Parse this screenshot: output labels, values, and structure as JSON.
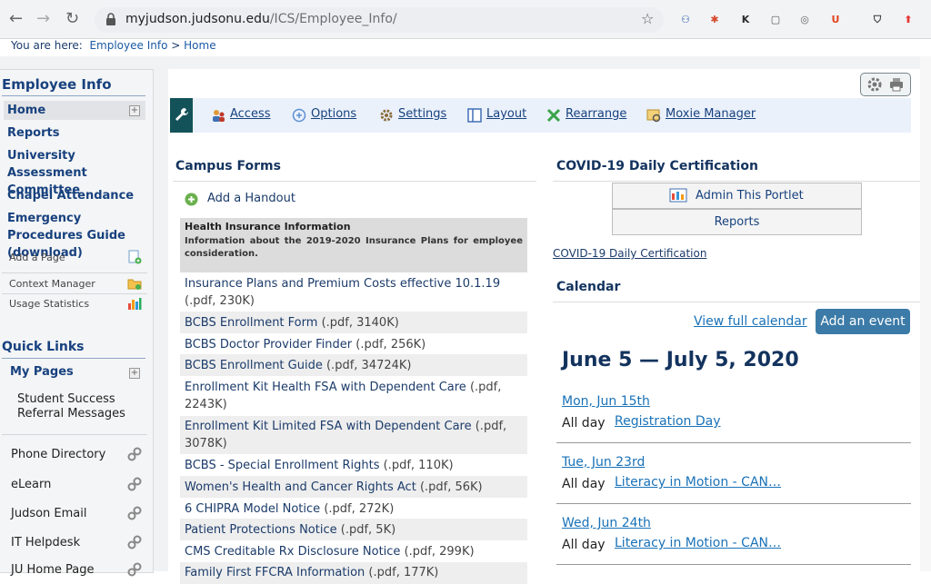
{
  "browser": {
    "url_host": "myjudson.judsonu.edu",
    "url_path": "/ICS/Employee_Info/",
    "extensions": [
      {
        "name": "ext-badge-blue",
        "color": "#2a56a6",
        "glyph": "⚇"
      },
      {
        "name": "ext-flame",
        "color": "#d5462a",
        "glyph": "✱"
      },
      {
        "name": "ext-k",
        "color": "#2b2b2b",
        "glyph": "K"
      },
      {
        "name": "ext-frame",
        "color": "#555555",
        "glyph": "▢"
      },
      {
        "name": "ext-swirl",
        "color": "#666666",
        "glyph": "◎"
      },
      {
        "name": "ext-u",
        "color": "#e2441f",
        "glyph": "U"
      },
      {
        "name": "ext-shield",
        "color": "#3a3a3a",
        "glyph": "⛉"
      },
      {
        "name": "ext-red-up",
        "color": "#e53935",
        "glyph": "⬆"
      }
    ]
  },
  "breadcrumb": {
    "prefix": "You are here:",
    "part1": "Employee Info",
    "sep": ">",
    "part2": "Home"
  },
  "sidebar": {
    "heading": "Employee Info",
    "items": [
      {
        "label": "Home"
      },
      {
        "label": "Reports"
      },
      {
        "label": "University Assessment Committee"
      },
      {
        "label": "Chapel Attendance"
      },
      {
        "label": "Emergency Procedures Guide (download)"
      }
    ],
    "tools": [
      "Add a Page",
      "Context Manager",
      "Usage Statistics"
    ],
    "quick_links_heading": "Quick Links",
    "my_pages": "My Pages",
    "student_success": "Student Success Referral Messages",
    "links": [
      "Phone Directory",
      "eLearn",
      "Judson Email",
      "IT Helpdesk",
      "JU Home Page"
    ]
  },
  "toolbar": {
    "items": [
      "Access",
      "Options",
      "Settings",
      "Layout",
      "Rearrange",
      "Moxie Manager"
    ]
  },
  "campus_forms": {
    "title": "Campus Forms",
    "add_handout": "Add a Handout",
    "hi_title": "Health Insurance Information",
    "hi_desc": "Information about the 2019-2020 Insurance Plans for employee consideration.",
    "rows": [
      {
        "label": "Insurance Plans and Premium Costs effective 10.1.19",
        "meta": "(.pdf, 230K)"
      },
      {
        "label": "BCBS Enrollment Form",
        "meta": "(.pdf, 3140K)"
      },
      {
        "label": "BCBS Doctor Provider Finder",
        "meta": "(.pdf, 256K)"
      },
      {
        "label": "BCBS Enrollment Guide",
        "meta": "(.pdf, 34724K)"
      },
      {
        "label": "Enrollment Kit Health FSA with Dependent Care",
        "meta": "(.pdf, 2243K)"
      },
      {
        "label": "Enrollment Kit Limited FSA with Dependent Care",
        "meta": "(.pdf, 3078K)"
      },
      {
        "label": "BCBS - Special Enrollment Rights",
        "meta": "(.pdf, 110K)"
      },
      {
        "label": "Women's Health and Cancer Rights Act",
        "meta": "(.pdf, 56K)"
      },
      {
        "label": "6 CHIPRA Model Notice",
        "meta": "(.pdf, 272K)"
      },
      {
        "label": "Patient Protections Notice",
        "meta": "(.pdf, 5K)"
      },
      {
        "label": "CMS Creditable Rx Disclosure Notice",
        "meta": "(.pdf, 299K)"
      },
      {
        "label": "Family First FFCRA Information",
        "meta": "(.pdf, 177K)"
      }
    ]
  },
  "covid": {
    "title": "COVID-19 Daily Certification",
    "admin_btn": "Admin This Portlet",
    "reports_btn": "Reports",
    "link": "COVID-19 Daily Certification"
  },
  "calendar": {
    "title": "Calendar",
    "view_full": "View full calendar",
    "add_event": "Add an event",
    "range": "June 5 — July 5, 2020",
    "all_day": "All day",
    "events": [
      {
        "date": "Mon, Jun 15th",
        "name": "Registration Day"
      },
      {
        "date": "Tue, Jun 23rd",
        "name": "Literacy in Motion - CAN…"
      },
      {
        "date": "Wed, Jun 24th",
        "name": "Literacy in Motion - CAN…"
      }
    ]
  }
}
